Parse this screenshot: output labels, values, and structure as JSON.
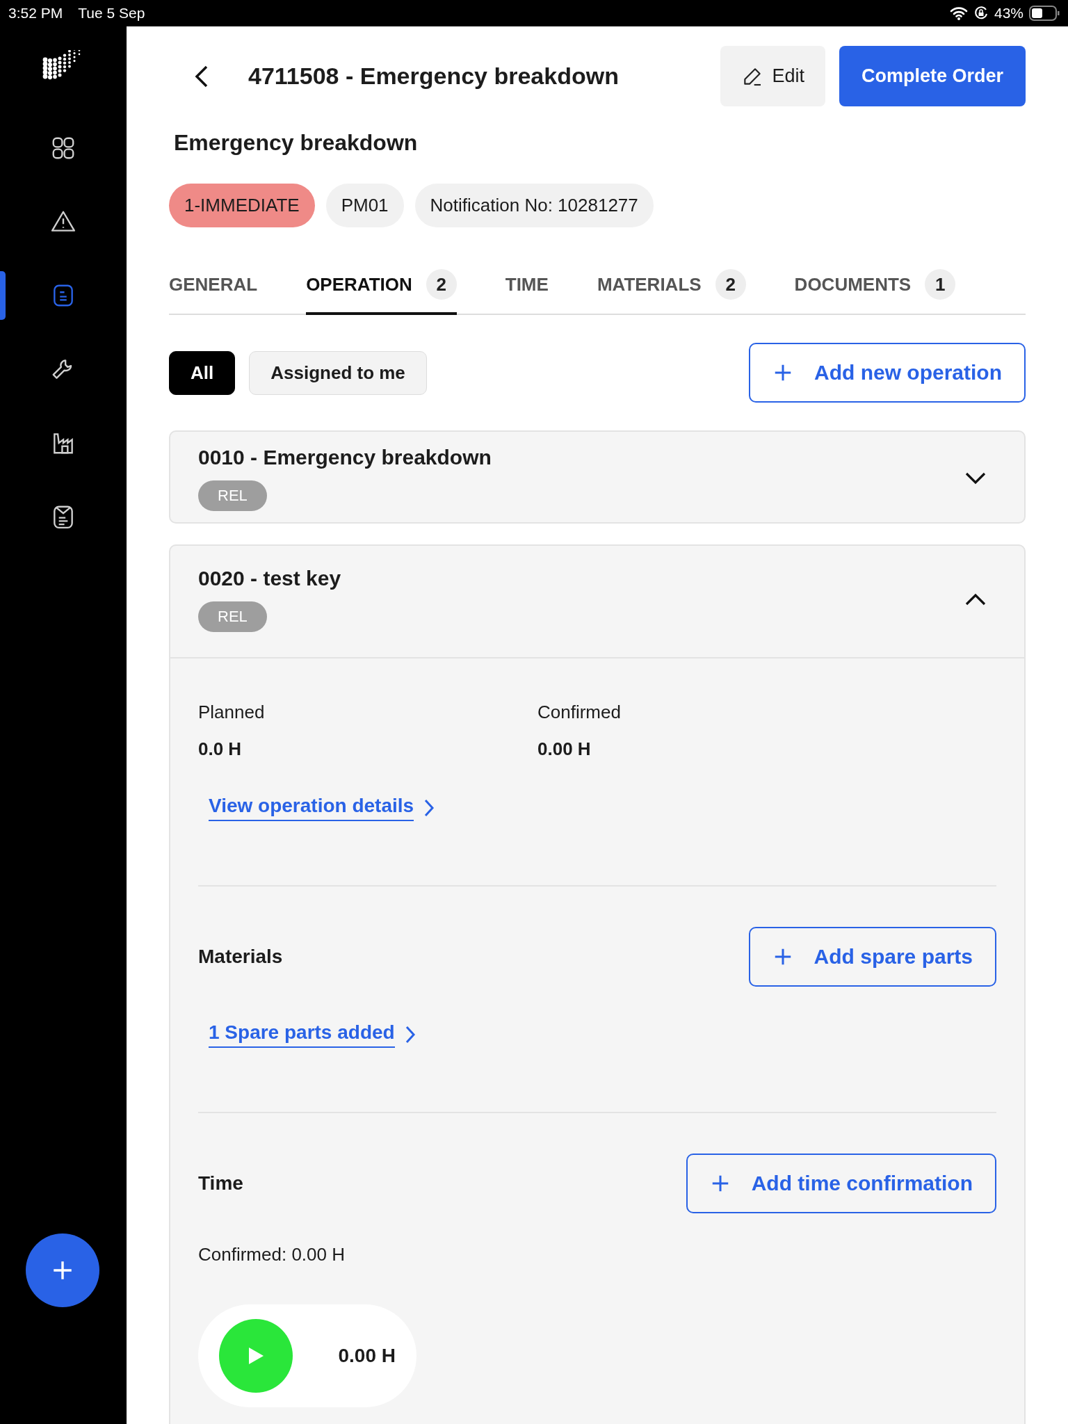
{
  "status_bar": {
    "time": "3:52 PM",
    "date": "Tue 5 Sep",
    "battery": "43%"
  },
  "sidebar": {
    "items": [
      {
        "selected": false
      },
      {
        "selected": false
      },
      {
        "selected": true
      },
      {
        "selected": false
      },
      {
        "selected": false
      },
      {
        "selected": false
      }
    ]
  },
  "header": {
    "title": "4711508 - Emergency breakdown",
    "edit_button": "Edit",
    "complete_button": "Complete Order"
  },
  "subtitle": "Emergency breakdown",
  "chips": [
    {
      "label": "1-IMMEDIATE",
      "kind": "priority"
    },
    {
      "label": "PM01",
      "kind": "plain"
    },
    {
      "label": "Notification No: 10281277",
      "kind": "plain"
    }
  ],
  "tabs": [
    {
      "label": "GENERAL",
      "selected": false
    },
    {
      "label": "OPERATION",
      "count": "2",
      "selected": true
    },
    {
      "label": "TIME",
      "selected": false
    },
    {
      "label": "MATERIALS",
      "count": "2",
      "selected": false
    },
    {
      "label": "DOCUMENTS",
      "count": "1",
      "selected": false
    }
  ],
  "filters": [
    {
      "label": "All",
      "selected": true
    },
    {
      "label": "Assigned to me",
      "selected": false
    }
  ],
  "add_operation_button": "Add new operation",
  "operations": [
    {
      "title": "0010 - Emergency breakdown",
      "status": "REL",
      "expanded": false
    },
    {
      "title": "0020 - test key",
      "status": "REL",
      "expanded": true,
      "details": {
        "planned_label": "Planned",
        "planned_value": "0.0 H",
        "confirmed_label": "Confirmed",
        "confirmed_value": "0.00 H",
        "details_link": "View operation details",
        "materials": {
          "title": "Materials",
          "button": "Add spare parts",
          "link": "1 Spare parts added"
        },
        "time": {
          "title": "Time",
          "button": "Add time confirmation",
          "confirmed": "Confirmed: 0.00 H",
          "timer": "0.00 H"
        }
      }
    }
  ]
}
